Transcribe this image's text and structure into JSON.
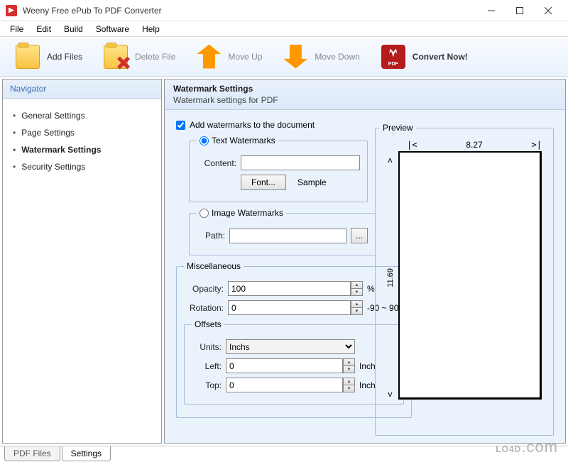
{
  "window": {
    "title": "Weeny Free ePub To PDF Converter"
  },
  "menu": {
    "file": "File",
    "edit": "Edit",
    "build": "Build",
    "software": "Software",
    "help": "Help"
  },
  "toolbar": {
    "add_files": "Add Files",
    "delete_file": "Delete File",
    "move_up": "Move Up",
    "move_down": "Move Down",
    "convert_now": "Convert Now!"
  },
  "sidebar": {
    "title": "Navigator",
    "items": [
      {
        "label": "General Settings",
        "active": false
      },
      {
        "label": "Page Settings",
        "active": false
      },
      {
        "label": "Watermark Settings",
        "active": true
      },
      {
        "label": "Security Settings",
        "active": false
      }
    ]
  },
  "panel": {
    "title": "Watermark Settings",
    "subtitle": "Watermark settings for PDF",
    "add_watermarks_label": "Add watermarks to the document",
    "text_watermarks_label": "Text Watermarks",
    "content_label": "Content:",
    "content_value": "",
    "font_btn": "Font...",
    "sample_label": "Sample",
    "image_watermarks_label": "Image Watermarks",
    "path_label": "Path:",
    "path_value": "",
    "browse_btn": "...",
    "misc_label": "Miscellaneous",
    "opacity_label": "Opacity:",
    "opacity_value": "100",
    "opacity_unit": "%",
    "rotation_label": "Rotation:",
    "rotation_value": "0",
    "rotation_hint": "-90 ~ 90",
    "offsets_label": "Offsets",
    "units_label": "Units:",
    "units_value": "Inchs",
    "left_label": "Left:",
    "left_value": "0",
    "left_unit": "Inch",
    "top_label": "Top:",
    "top_value": "0",
    "top_unit": "Inch",
    "preview_label": "Preview",
    "preview_width": "8.27",
    "preview_height": "11.69"
  },
  "tabs": {
    "pdf_files": "PDF Files",
    "settings": "Settings"
  },
  "branding": {
    "site": "LO4D.com"
  }
}
